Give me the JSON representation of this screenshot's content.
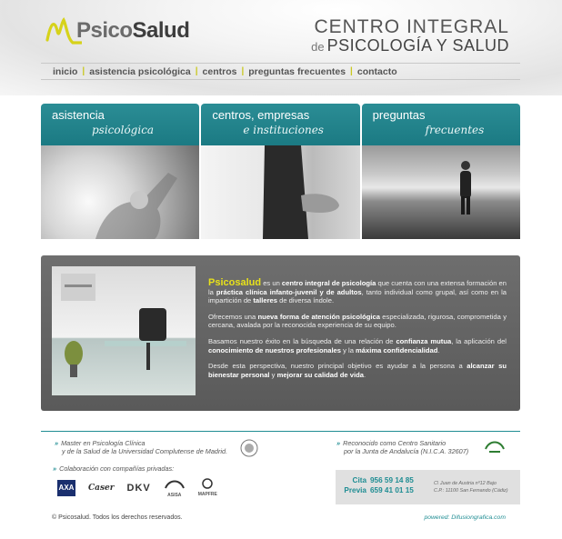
{
  "header": {
    "logo_left": "Psico",
    "logo_right": "Salud",
    "tagline_line1": "CENTRO INTEGRAL",
    "tagline_de": "de",
    "tagline_line2": "PSICOLOGÍA Y SALUD"
  },
  "nav": {
    "items": [
      "inicio",
      "asistencia psicológica",
      "centros",
      "preguntas frecuentes",
      "contacto"
    ],
    "separator": "|"
  },
  "panels": [
    {
      "title": "asistencia",
      "subtitle": "psicológica"
    },
    {
      "title": "centros, empresas",
      "subtitle": "e instituciones"
    },
    {
      "title": "preguntas",
      "subtitle": "frecuentes"
    }
  ],
  "info": {
    "brand": "Psicosalud",
    "p1a": " es un ",
    "p1b": "centro integral de psicología",
    "p1c": " que cuenta con una extensa formación en la ",
    "p1d": "práctica clínica infanto-juvenil y de adultos",
    "p1e": ", tanto individual como grupal, así como en la impartición de ",
    "p1f": "talleres",
    "p1g": " de diversa índole.",
    "p2a": "Ofrecemos una ",
    "p2b": "nueva forma de atención psicológica",
    "p2c": " especializada, rigurosa, comprometida y cercana, avalada por la reconocida experiencia de su equipo.",
    "p3a": "Basamos nuestro éxito en la búsqueda de una relación de ",
    "p3b": "confianza mutua",
    "p3c": ", la aplicación del ",
    "p3d": "conocimiento de nuestros profesionales",
    "p3e": " y la ",
    "p3f": "máxima confidencialidad",
    "p3g": ".",
    "p4a": "Desde esta perspectiva, nuestro principal objetivo es ayudar a la persona a ",
    "p4b": "alcanzar su bienestar personal",
    "p4c": " y ",
    "p4d": "mejorar su calidad de vida",
    "p4e": "."
  },
  "footer": {
    "bullet": "»",
    "cert1_line1": "Master en Psicología Clínica",
    "cert1_line2": "y de la Salud de la Universidad Complutense de Madrid.",
    "cert2_line1": "Reconocido como Centro Sanitario",
    "cert2_line2": "por la Junta de Andalucía (N.I.C.A. 32607)",
    "collab": "Colaboración con compañías privadas:",
    "partners": [
      "AXA",
      "Caser",
      "DKV",
      "ASISA",
      "MAPFRE"
    ],
    "cita_label": "Cita",
    "cita_phone": "956 59 14 85",
    "previa_label": "Previa",
    "previa_phone": "659 41 01 15",
    "addr1": "C\\ Juan de Austria nº12 Bajo",
    "addr2": "C.P.: 11100 San Fernando (Cádiz)",
    "copyright": "© Psicosalud. Todos los derechos reservados.",
    "powered": "powered: Difusiongrafica.com"
  },
  "colors": {
    "teal": "#1f8d93",
    "yellow": "#e8e11b",
    "grey_box": "#666666"
  }
}
